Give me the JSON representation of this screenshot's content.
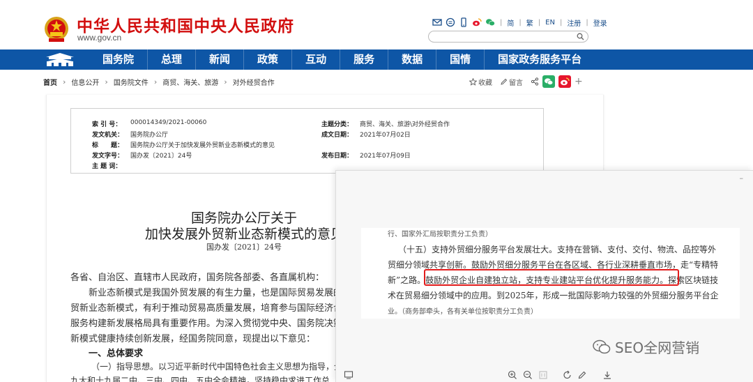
{
  "header": {
    "site_title": "中华人民共和国中央人民政府",
    "site_url": "www.gov.cn",
    "utility_links": [
      "简",
      "繁",
      "EN",
      "注册",
      "登录"
    ],
    "search_placeholder": ""
  },
  "nav": {
    "items": [
      "国务院",
      "总理",
      "新闻",
      "政策",
      "互动",
      "服务",
      "数据",
      "国情",
      "国家政务服务平台"
    ]
  },
  "breadcrumb": {
    "items": [
      "首页",
      "信息公开",
      "国务院文件",
      "商贸、海关、旅游",
      "对外经贸合作"
    ],
    "actions": {
      "favorite": "收藏",
      "comment": "留言"
    }
  },
  "meta": {
    "index_label": "索 引 号：",
    "index_value": "000014349/2021-00060",
    "issuer_label": "发文机关：",
    "issuer_value": "国务院办公厅",
    "title_label": "标　　题：",
    "title_value": "国务院办公厅关于加快发展外贸新业态新模式的意见",
    "doc_no_label": "发文字号：",
    "doc_no_value": "国办发〔2021〕24号",
    "subject_label": "主 题 词：",
    "subject_value": "",
    "category_label": "主题分类：",
    "category_value": "商贸、海关、旅游\\对外经贸合作",
    "written_label": "成文日期：",
    "written_value": "2021年07月02日",
    "published_label": "发布日期：",
    "published_value": "2021年07月09日"
  },
  "document": {
    "title_line1": "国务院办公厅关于",
    "title_line2": "加快发展外贸新业态新模式的意见",
    "doc_number": "国办发〔2021〕24号",
    "salutation": "各省、自治区、直辖市人民政府，国务院各部委、各直属机构：",
    "para1_line1": "新业态新模式是我国外贸发展的有生力量，也是国际贸易发展的重要",
    "para1_line2": "贸新业态新模式，有利于推动贸易高质量发展，培育参与国际经济合作",
    "para1_line3": "服务构建新发展格局具有重要作用。为深入贯彻党中央、国务院决策部",
    "para1_line4": "新模式健康持续创新发展，经国务院同意，现提出以下意见：",
    "section1_heading": "一、总体要求",
    "guideline_line": "（一）指导思想。以习近平新时代中国特色社会主义思想为指导，全",
    "guideline_line2": "九大和十九届二中、三中、四中、五中全会精神，坚持稳中求进工作总"
  },
  "viewer": {
    "line0": "行、国家外汇局按职责分工负责）",
    "line1": "（十五）支持外贸细分服务平台发展壮大。支持在营销、支付、交付、物流、品控等外",
    "line2": "贸细分领域共享创新。鼓励外贸细分服务平台在各区域、各行业深耕垂直市场，走“专精特",
    "line3a": "新”之路。",
    "line3b": "鼓励外贸企业自建独立站，支持专业建站平台优化提升服务能力。",
    "line3c": "探索区块链技",
    "line4": "术在贸易细分领域中的应用。到2025年，形成一批国际影响力较强的外贸细分服务平台企",
    "line5": "业。（商务部牵头，各有关单位按职责分工负责）",
    "watermark": "SEO全网营销"
  },
  "colors": {
    "brand_red": "#d20f0f",
    "nav_blue": "#0e56a6",
    "highlight_red": "#e21b1b"
  },
  "icons": [
    "national-emblem-icon",
    "mail-icon",
    "chat-icon",
    "phone-icon",
    "weibo-icon",
    "wechat-icon",
    "search-icon",
    "star-icon",
    "pencil-icon",
    "share-icon",
    "plus-icon",
    "monitor-icon",
    "zoom-in-icon",
    "zoom-out-icon",
    "rotate-icon",
    "draw-icon",
    "download-icon"
  ]
}
